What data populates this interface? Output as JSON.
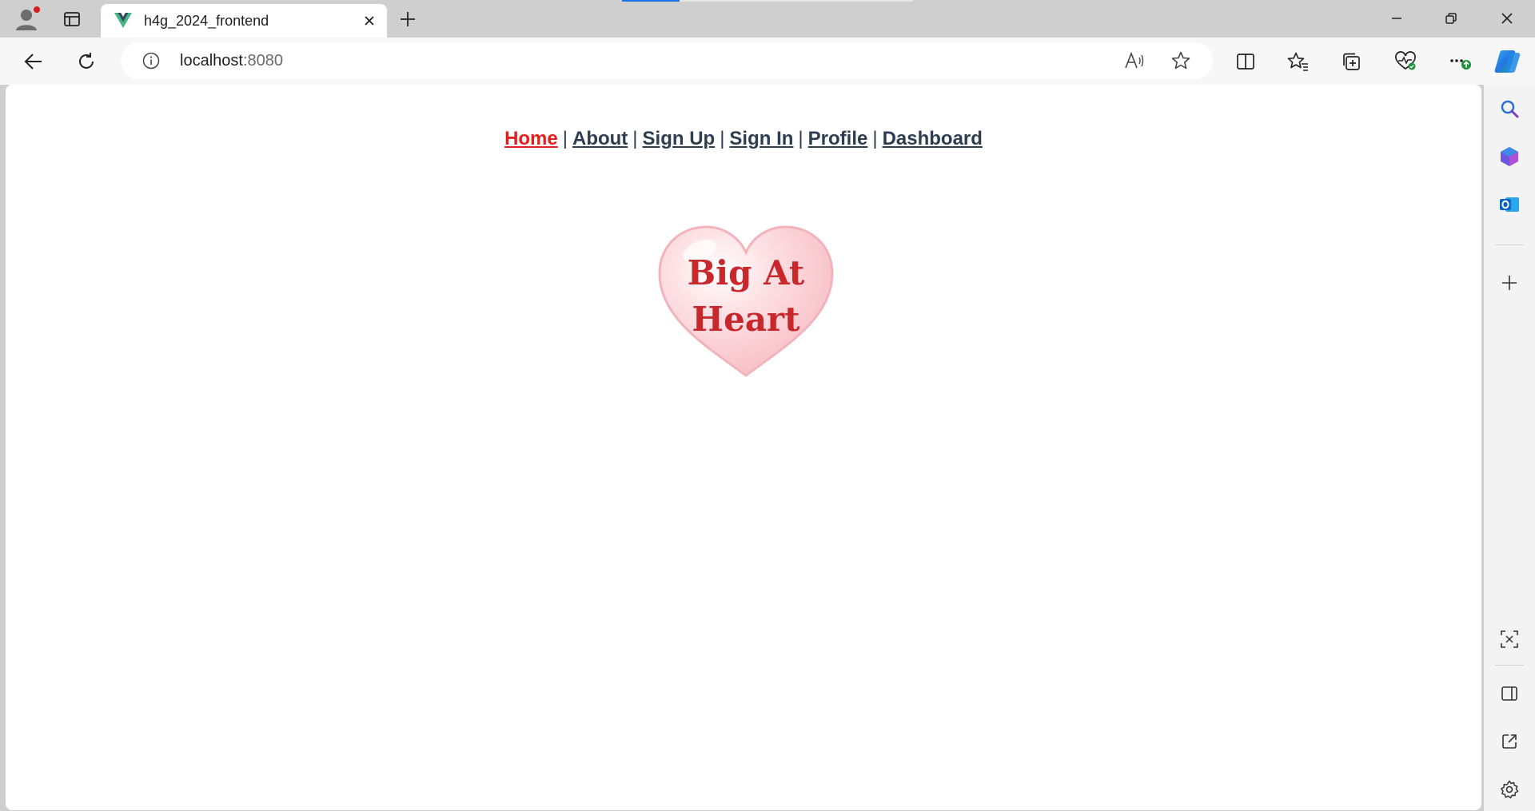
{
  "browser": {
    "tab": {
      "title": "h4g_2024_frontend",
      "favicon": "vue-logo-icon"
    },
    "address": {
      "host": "localhost",
      "port": ":8080"
    },
    "accent": "#1a73e8"
  },
  "nav": {
    "links": [
      {
        "label": "Home",
        "active": true
      },
      {
        "label": "About"
      },
      {
        "label": "Sign Up"
      },
      {
        "label": "Sign In"
      },
      {
        "label": "Profile"
      },
      {
        "label": "Dashboard"
      }
    ],
    "separator": "|",
    "active_color": "#e51e1e",
    "color": "#2c3e50"
  },
  "logo": {
    "line1": "Big At",
    "line2": "Heart",
    "text_color": "#c8272b",
    "fill_color": "#f9c9cf"
  }
}
